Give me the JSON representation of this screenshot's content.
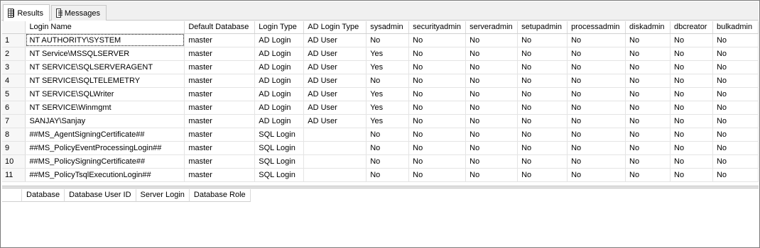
{
  "tabs": [
    {
      "label": "Results",
      "icon": "grid-icon",
      "active": true
    },
    {
      "label": "Messages",
      "icon": "message-icon",
      "active": false
    }
  ],
  "grid": {
    "columns": [
      "Login Name",
      "Default Database",
      "Login Type",
      "AD Login Type",
      "sysadmin",
      "securityadmin",
      "serveradmin",
      "setupadmin",
      "processadmin",
      "diskadmin",
      "dbcreator",
      "bulkadmin"
    ],
    "rows": [
      [
        "1",
        "NT AUTHORITY\\SYSTEM",
        "master",
        "AD Login",
        "AD User",
        "No",
        "No",
        "No",
        "No",
        "No",
        "No",
        "No",
        "No"
      ],
      [
        "2",
        "NT Service\\MSSQLSERVER",
        "master",
        "AD Login",
        "AD User",
        "Yes",
        "No",
        "No",
        "No",
        "No",
        "No",
        "No",
        "No"
      ],
      [
        "3",
        "NT SERVICE\\SQLSERVERAGENT",
        "master",
        "AD Login",
        "AD User",
        "Yes",
        "No",
        "No",
        "No",
        "No",
        "No",
        "No",
        "No"
      ],
      [
        "4",
        "NT SERVICE\\SQLTELEMETRY",
        "master",
        "AD Login",
        "AD User",
        "No",
        "No",
        "No",
        "No",
        "No",
        "No",
        "No",
        "No"
      ],
      [
        "5",
        "NT SERVICE\\SQLWriter",
        "master",
        "AD Login",
        "AD User",
        "Yes",
        "No",
        "No",
        "No",
        "No",
        "No",
        "No",
        "No"
      ],
      [
        "6",
        "NT SERVICE\\Winmgmt",
        "master",
        "AD Login",
        "AD User",
        "Yes",
        "No",
        "No",
        "No",
        "No",
        "No",
        "No",
        "No"
      ],
      [
        "7",
        "SANJAY\\Sanjay",
        "master",
        "AD Login",
        "AD User",
        "Yes",
        "No",
        "No",
        "No",
        "No",
        "No",
        "No",
        "No"
      ],
      [
        "8",
        "##MS_AgentSigningCertificate##",
        "master",
        "SQL Login",
        "",
        "No",
        "No",
        "No",
        "No",
        "No",
        "No",
        "No",
        "No"
      ],
      [
        "9",
        "##MS_PolicyEventProcessingLogin##",
        "master",
        "SQL Login",
        "",
        "No",
        "No",
        "No",
        "No",
        "No",
        "No",
        "No",
        "No"
      ],
      [
        "10",
        "##MS_PolicySigningCertificate##",
        "master",
        "SQL Login",
        "",
        "No",
        "No",
        "No",
        "No",
        "No",
        "No",
        "No",
        "No"
      ],
      [
        "11",
        "##MS_PolicyTsqlExecutionLogin##",
        "master",
        "SQL Login",
        "",
        "No",
        "No",
        "No",
        "No",
        "No",
        "No",
        "No",
        "No"
      ]
    ]
  },
  "lower_grid": {
    "columns": [
      "Database",
      "Database User ID",
      "Server Login",
      "Database Role"
    ]
  }
}
